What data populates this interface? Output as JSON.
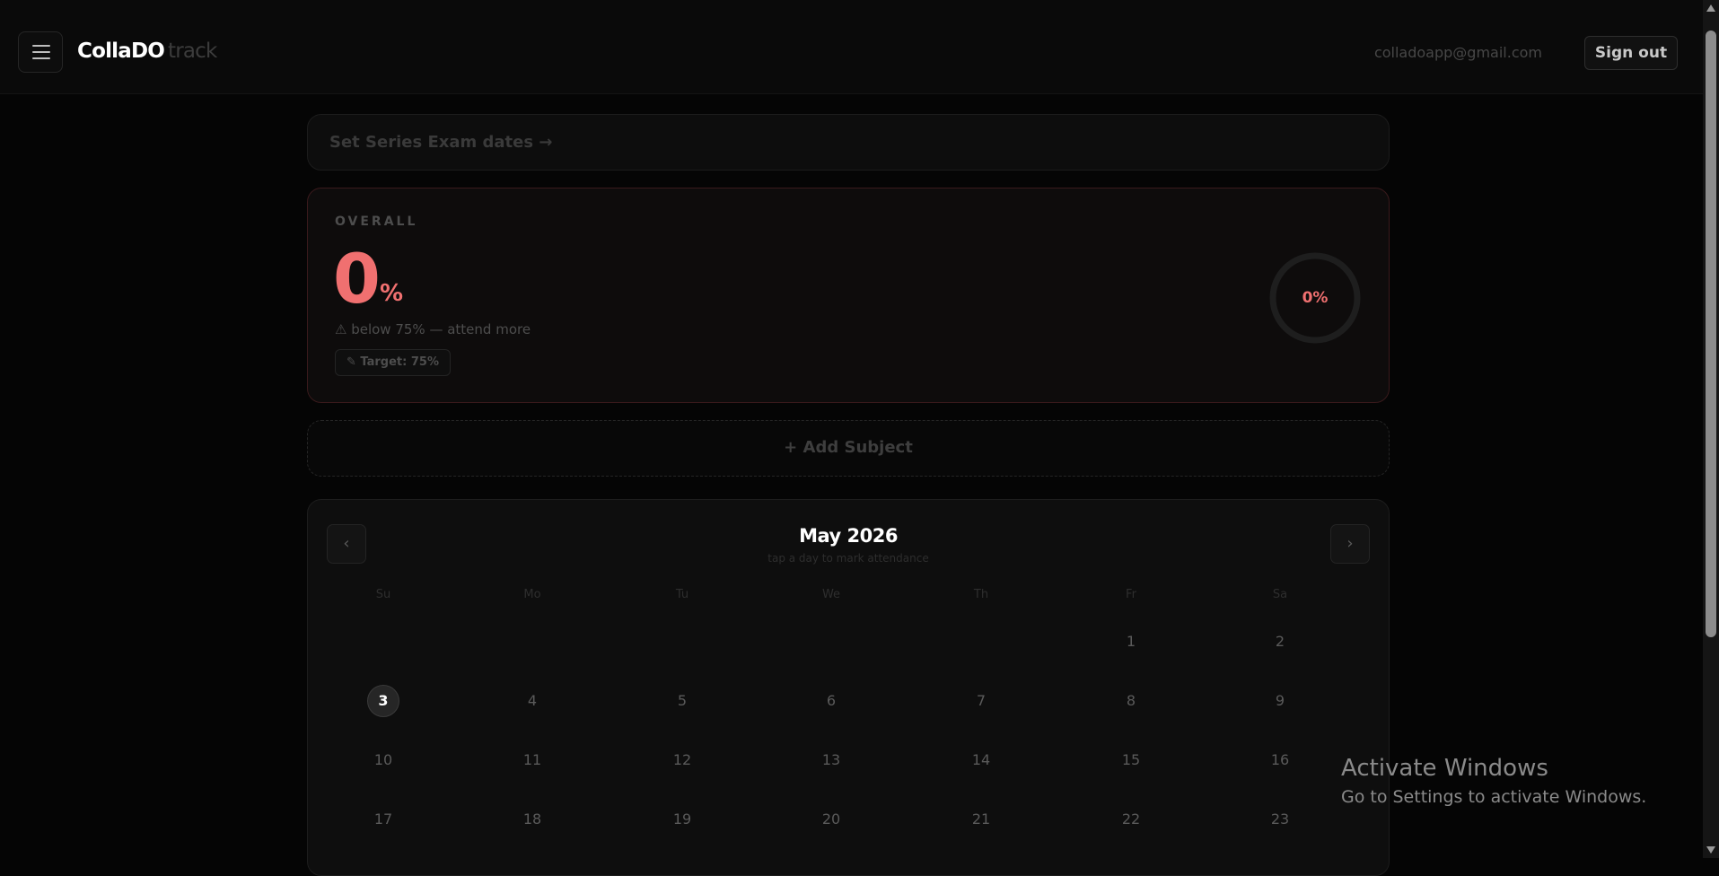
{
  "header": {
    "brand_primary": "CollaDO",
    "brand_secondary": "track",
    "email": "colladoapp@gmail.com",
    "signout_label": "Sign out"
  },
  "series_link": "Set Series Exam dates →",
  "overall": {
    "label": "OVERALL",
    "value": "0",
    "unit": "%",
    "warning": "⚠ below 75% — attend more",
    "target": "✎ Target: 75%",
    "ring_text": "0%",
    "ring_fraction": 0
  },
  "add_subject": "+ Add Subject",
  "calendar": {
    "month": "May 2026",
    "hint": "tap a day to mark attendance",
    "prev": "‹",
    "next": "›",
    "weekdays": [
      "Su",
      "Mo",
      "Tu",
      "We",
      "Th",
      "Fr",
      "Sa"
    ],
    "weeks": [
      [
        "",
        "",
        "",
        "",
        "",
        "1",
        "2"
      ],
      [
        "3",
        "4",
        "5",
        "6",
        "7",
        "8",
        "9"
      ],
      [
        "10",
        "11",
        "12",
        "13",
        "14",
        "15",
        "16"
      ],
      [
        "17",
        "18",
        "19",
        "20",
        "21",
        "22",
        "23"
      ]
    ],
    "today": "3"
  },
  "watermark": {
    "title": "Activate Windows",
    "subtitle": "Go to Settings to activate Windows."
  },
  "colors": {
    "accent": "#f07070",
    "background": "#050505"
  }
}
